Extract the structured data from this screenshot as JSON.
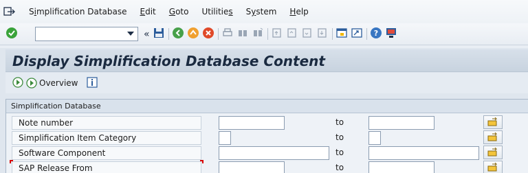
{
  "menubar": {
    "items": [
      {
        "pre": "S",
        "u": "i",
        "post": "mplification Database"
      },
      {
        "pre": "",
        "u": "E",
        "post": "dit"
      },
      {
        "pre": "",
        "u": "G",
        "post": "oto"
      },
      {
        "pre": "Utilitie",
        "u": "s",
        "post": ""
      },
      {
        "pre": "S",
        "u": "y",
        "post": "stem"
      },
      {
        "pre": "",
        "u": "H",
        "post": "elp"
      }
    ]
  },
  "toolbar": {
    "command_field_value": "",
    "icons": [
      "enter-check-icon",
      "command-field",
      "history-back-icon",
      "save-icon",
      "back-icon",
      "exit-icon",
      "cancel-icon",
      "print-icon",
      "find-icon",
      "find-next-icon",
      "first-page-icon",
      "prev-page-icon",
      "next-page-icon",
      "last-page-icon",
      "new-session-icon",
      "shortcut-icon",
      "help-icon",
      "customize-layout-icon"
    ]
  },
  "page": {
    "title": "Display Simplification Database Content"
  },
  "apptoolbar": {
    "overview_label": "Overview"
  },
  "group": {
    "title": "Simplification Database",
    "rows": [
      {
        "label": "Note number",
        "from": "",
        "to_label": "to",
        "to": ""
      },
      {
        "label": "Simplification Item Category",
        "from": "",
        "to_label": "to",
        "to": ""
      },
      {
        "label": "Software Component",
        "from": "",
        "to_label": "to",
        "to": ""
      },
      {
        "label": "SAP Release From",
        "from": "",
        "to_label": "to",
        "to": ""
      }
    ]
  },
  "colors": {
    "title_text": "#1a2a40",
    "required_marker": "#d80000",
    "ok_green": "#3aa33a"
  }
}
